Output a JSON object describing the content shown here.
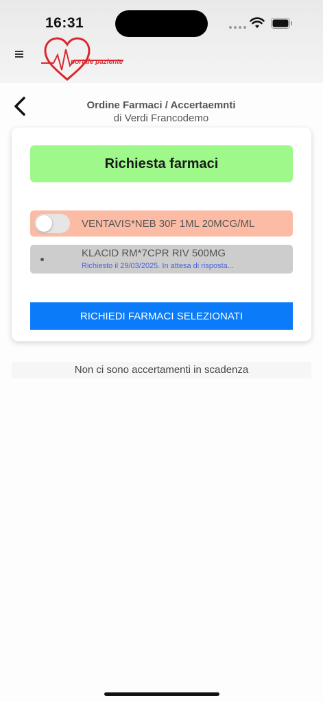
{
  "status_bar": {
    "time": "16:31"
  },
  "header": {
    "logo_text": "portale paziente"
  },
  "page": {
    "title": "Ordine Farmaci / Accertaemnti",
    "subtitle": "di Verdi Francodemo"
  },
  "card": {
    "header_label": "Richiesta farmaci",
    "drugs": [
      {
        "name": "VENTAVIS*NEB 30F 1ML 20MCG/ML",
        "selected": false,
        "color": "#fbbba4"
      },
      {
        "name": "KLACID RM*7CPR RIV 500MG",
        "status": "Richiesto il 29/03/2025. In attesa di risposta...",
        "color": "#cdcdcd"
      }
    ],
    "submit_label": "RICHIEDI FARMACI SELEZIONATI"
  },
  "empty_message": "Non ci sono accertamenti in scadenza",
  "colors": {
    "accent": "#0c7bf9",
    "header_green": "#9ef88a",
    "logo_red": "#d8282f"
  }
}
